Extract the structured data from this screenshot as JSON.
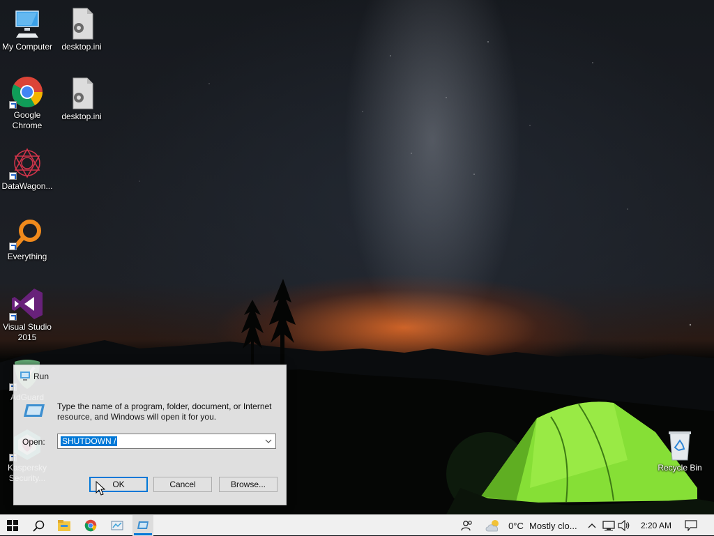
{
  "desktop": {
    "icons": [
      {
        "label": "My Computer",
        "icon": "computer-icon",
        "shortcut": false
      },
      {
        "label": "desktop.ini",
        "icon": "settings-file-icon",
        "shortcut": false
      },
      {
        "label": "Google Chrome",
        "icon": "chrome-icon",
        "shortcut": true
      },
      {
        "label": "desktop.ini",
        "icon": "settings-file-icon",
        "shortcut": false
      },
      {
        "label": "DataWagon...",
        "icon": "datawagon-icon",
        "shortcut": true
      },
      {
        "label": "Everything",
        "icon": "everything-search-icon",
        "shortcut": true
      },
      {
        "label": "Visual Studio 2015",
        "icon": "visual-studio-icon",
        "shortcut": true
      },
      {
        "label": "AdGuard",
        "icon": "adguard-shield-icon",
        "shortcut": true
      },
      {
        "label": "Kaspersky Security...",
        "icon": "kaspersky-icon",
        "shortcut": true
      },
      {
        "label": "Recycle Bin",
        "icon": "recycle-bin-icon",
        "shortcut": false
      }
    ]
  },
  "run_dialog": {
    "title": "Run",
    "description": "Type the name of a program, folder, document, or Internet resource, and Windows will open it for you.",
    "open_label": "Open:",
    "open_value": "SHUTDOWN /",
    "ok_label": "OK",
    "cancel_label": "Cancel",
    "browse_label": "Browse..."
  },
  "taskbar": {
    "start_icon": "windows-logo-icon",
    "search_icon": "search-icon",
    "pinned": [
      "file-explorer-icon",
      "chrome-icon",
      "control-panel-icon",
      "run-dialog-icon"
    ],
    "people_icon": "people-icon",
    "weather_temp": "0°C",
    "weather_text": "Mostly clo...",
    "tray_icons": [
      "chevron-up-icon",
      "network-icon",
      "volume-icon"
    ],
    "clock": "2:20 AM",
    "notification_icon": "action-center-icon"
  },
  "colors": {
    "accent": "#0078d7",
    "taskbar_bg": "#f0f0f0",
    "tent_green": "#8fe63a",
    "horizon_orange": "#e8702a"
  }
}
